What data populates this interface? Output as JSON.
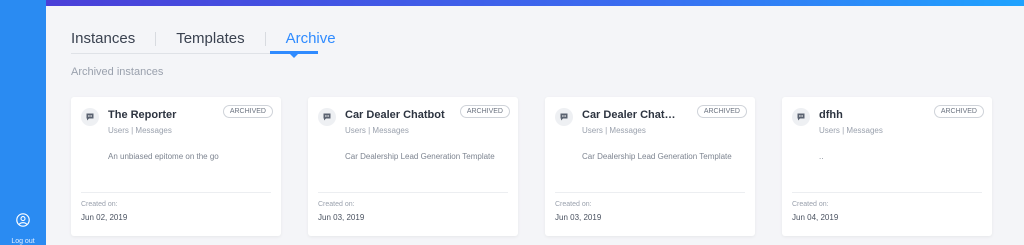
{
  "sidebar": {
    "logout_label": "Log out"
  },
  "tabs": [
    {
      "label": "Instances"
    },
    {
      "label": "Templates"
    },
    {
      "label": "Archive"
    }
  ],
  "section_title": "Archived instances",
  "cards": [
    {
      "title": "The Reporter",
      "badge": "ARCHIVED",
      "meta": "Users | Messages",
      "description": "An unbiased epitome on the go",
      "created_label": "Created on:",
      "created_date": "Jun 02, 2019"
    },
    {
      "title": "Car Dealer Chatbot",
      "badge": "ARCHIVED",
      "meta": "Users | Messages",
      "description": "Car Dealership Lead Generation Template",
      "created_label": "Created on:",
      "created_date": "Jun 03, 2019"
    },
    {
      "title": "Car Dealer Chatbot clo...",
      "badge": "ARCHIVED",
      "meta": "Users | Messages",
      "description": "Car Dealership Lead Generation Template",
      "created_label": "Created on:",
      "created_date": "Jun 03, 2019"
    },
    {
      "title": "dfhh",
      "badge": "ARCHIVED",
      "meta": "Users | Messages",
      "description": "..",
      "created_label": "Created on:",
      "created_date": "Jun 04, 2019"
    }
  ]
}
